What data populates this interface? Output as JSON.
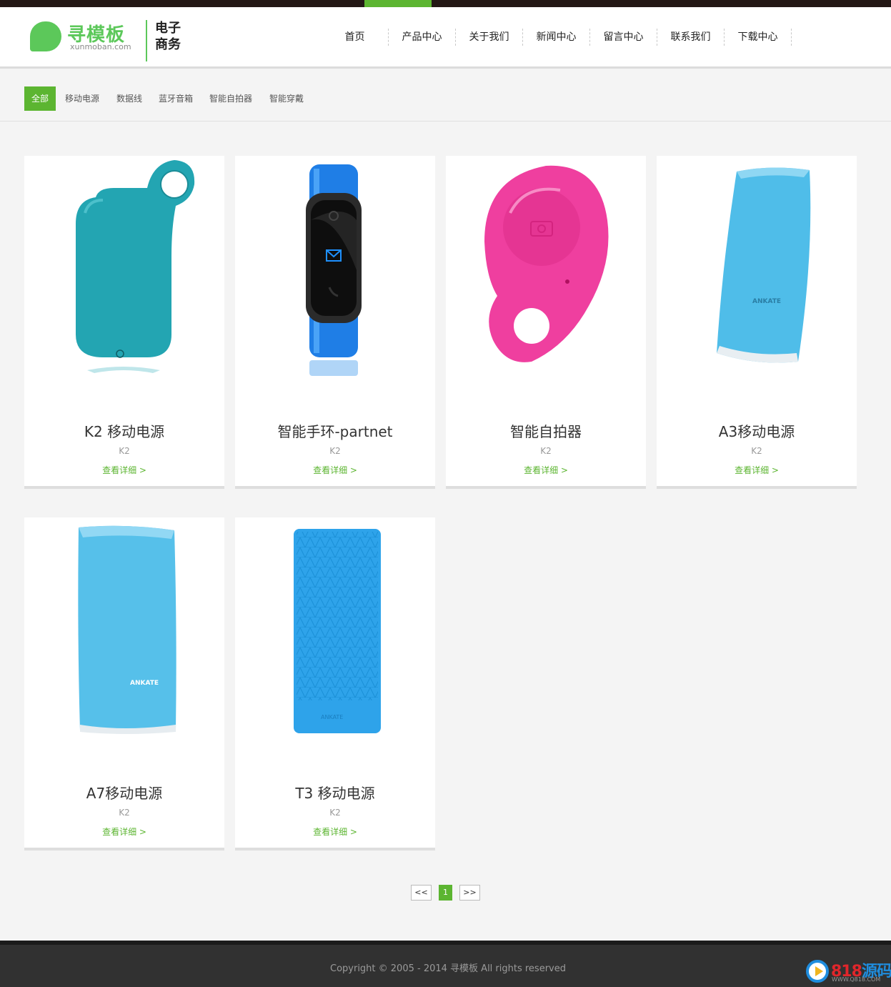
{
  "logo": {
    "name": "寻模板",
    "url": "xunmoban.com",
    "tagline": "电子商务"
  },
  "nav": [
    {
      "label": "首页"
    },
    {
      "label": "产品中心",
      "active": true
    },
    {
      "label": "关于我们"
    },
    {
      "label": "新闻中心"
    },
    {
      "label": "留言中心"
    },
    {
      "label": "联系我们"
    },
    {
      "label": "下载中心"
    }
  ],
  "filters": [
    {
      "label": "全部",
      "active": true
    },
    {
      "label": "移动电源"
    },
    {
      "label": "数据线"
    },
    {
      "label": "蓝牙音箱"
    },
    {
      "label": "智能自拍器"
    },
    {
      "label": "智能穿戴"
    }
  ],
  "products": [
    {
      "title": "K2 移动电源",
      "sub": "K2",
      "more": "查看详细 >",
      "image": "teal-power-bank-with-ring"
    },
    {
      "title": "智能手环-partnet",
      "sub": "K2",
      "more": "查看详细 >",
      "image": "blue-smart-band"
    },
    {
      "title": "智能自拍器",
      "sub": "K2",
      "more": "查看详细 >",
      "image": "pink-selfie-remote"
    },
    {
      "title": "A3移动电源",
      "sub": "K2",
      "more": "查看详细 >",
      "image": "light-blue-power-bank-a3"
    },
    {
      "title": "A7移动电源",
      "sub": "K2",
      "more": "查看详细 >",
      "image": "light-blue-power-bank-a7"
    },
    {
      "title": "T3 移动电源",
      "sub": "K2",
      "more": "查看详细 >",
      "image": "blue-textured-power-bank-t3"
    }
  ],
  "pager": {
    "prev": "<<",
    "current": "1",
    "next": ">>"
  },
  "footer": {
    "copyright": "Copyright © 2005 - 2014 寻模板 All rights reserved"
  },
  "watermark": {
    "brand_num": "818",
    "brand_cn": "源码",
    "site": "WWW.Q818.COM"
  },
  "colors": {
    "accent": "#5cb531",
    "top_bar": "#231815",
    "footer_bg": "#313131",
    "page_bg": "#f4f4f4"
  }
}
